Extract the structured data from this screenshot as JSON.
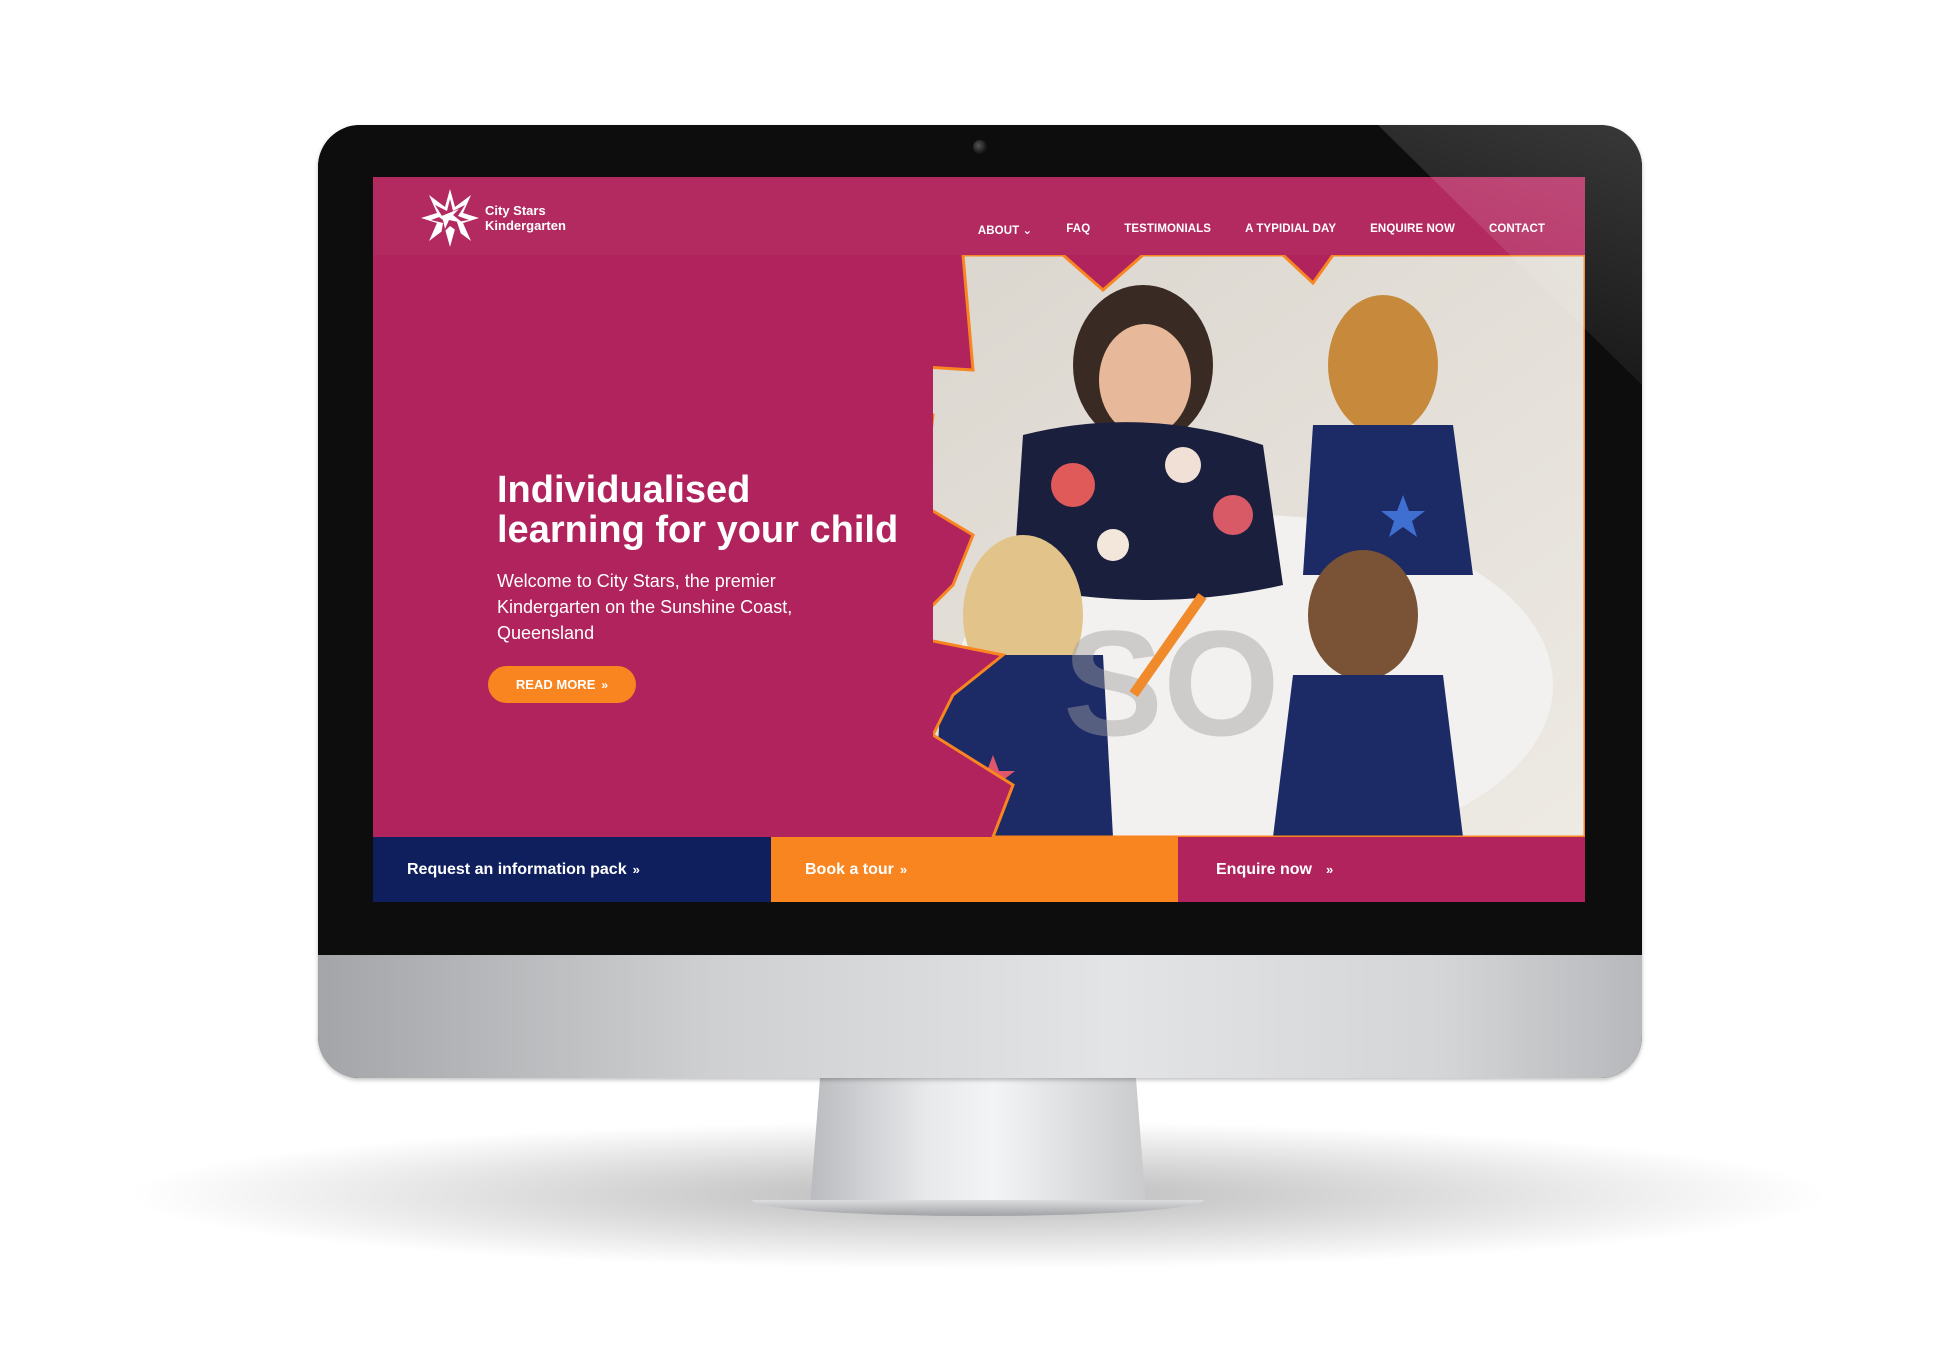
{
  "site": {
    "logo_line1": "City Stars",
    "logo_line2": "Kindergarten"
  },
  "nav": {
    "items": [
      {
        "label": "ABOUT ⌄"
      },
      {
        "label": "FAQ"
      },
      {
        "label": "TESTIMONIALS"
      },
      {
        "label": "A TYPIDIAL DAY"
      },
      {
        "label": "ENQUIRE NOW"
      },
      {
        "label": "CONTACT"
      }
    ]
  },
  "hero": {
    "title_line1": "Individualised",
    "title_line2": "learning for your child",
    "subtitle": "Welcome to City Stars, the premier Kindergarten on the Sunshine Coast, Queensland",
    "read_more": "READ MORE",
    "chevron": "»"
  },
  "cta": {
    "info_pack": "Request an information pack",
    "tour": "Book a tour",
    "enquire": "Enquire now",
    "chevron": "»"
  },
  "colors": {
    "brand_magenta": "#b0235c",
    "brand_orange": "#f98520",
    "brand_navy": "#0f1f5e"
  }
}
